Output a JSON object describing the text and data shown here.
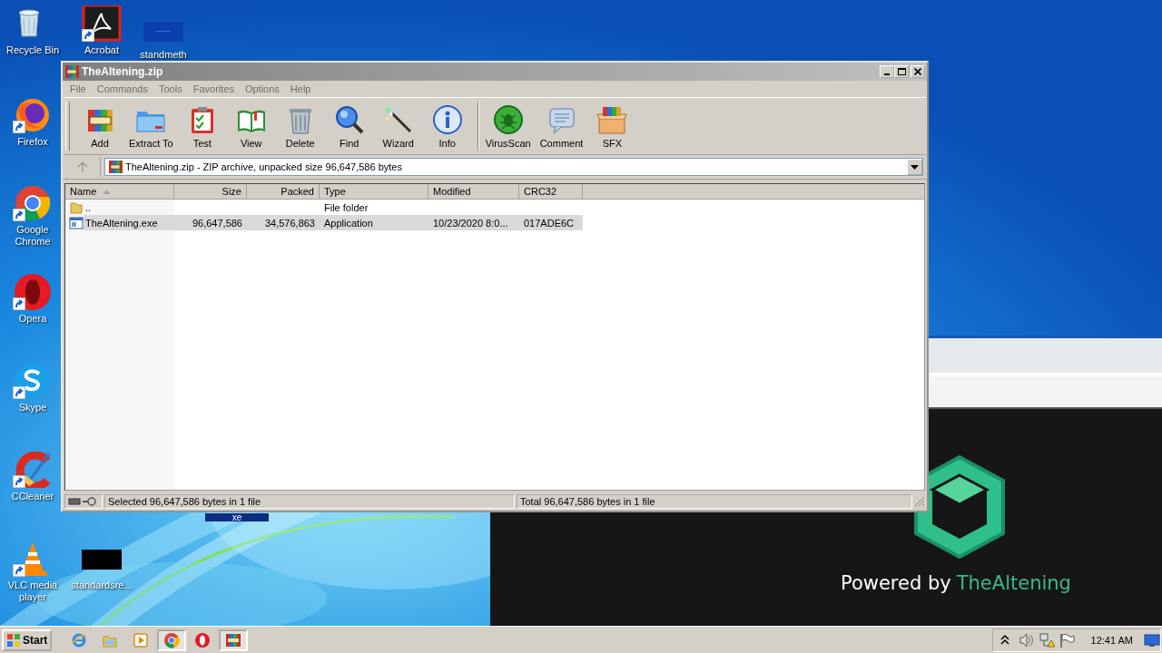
{
  "desktop": {
    "icons": [
      {
        "kind": "recycle",
        "label": "Recycle Bin",
        "shortcut": false
      },
      {
        "kind": "acrobat",
        "label": "Acrobat",
        "shortcut": true
      },
      {
        "kind": "thumb-blue",
        "label": "standmeth",
        "shortcut": false
      },
      {
        "kind": "firefox",
        "label": "Firefox",
        "shortcut": true
      },
      {
        "kind": "chrome",
        "label": "Google Chrome",
        "shortcut": true
      },
      {
        "kind": "opera",
        "label": "Opera",
        "shortcut": true
      },
      {
        "kind": "skype",
        "label": "Skype",
        "shortcut": true
      },
      {
        "kind": "ccleaner",
        "label": "CCleaner",
        "shortcut": true
      },
      {
        "kind": "vlc",
        "label": "VLC media player",
        "shortcut": true
      },
      {
        "kind": "thumb-black",
        "label": "standardsre...",
        "shortcut": false
      }
    ],
    "selected_label": "xe"
  },
  "background_page": {
    "powered_by": "Powered by",
    "brand": "TheAltening"
  },
  "window": {
    "title": "TheAltening.zip",
    "active": false,
    "menu": [
      "File",
      "Commands",
      "Tools",
      "Favorites",
      "Options",
      "Help"
    ],
    "toolbar": [
      {
        "kind": "add",
        "label": "Add"
      },
      {
        "kind": "extract",
        "label": "Extract To"
      },
      {
        "kind": "test",
        "label": "Test"
      },
      {
        "kind": "view",
        "label": "View"
      },
      {
        "kind": "delete",
        "label": "Delete"
      },
      {
        "kind": "find",
        "label": "Find"
      },
      {
        "kind": "wizard",
        "label": "Wizard"
      },
      {
        "kind": "info",
        "label": "Info"
      },
      {
        "kind": "separator"
      },
      {
        "kind": "virusscan",
        "label": "VirusScan"
      },
      {
        "kind": "comment",
        "label": "Comment"
      },
      {
        "kind": "sfx",
        "label": "SFX"
      }
    ],
    "address": "TheAltening.zip - ZIP archive, unpacked size 96,647,586 bytes",
    "table": {
      "columns": [
        {
          "label": "Name",
          "sorted": true
        },
        {
          "label": "Size",
          "sorted": false
        },
        {
          "label": "Packed",
          "sorted": false
        },
        {
          "label": "Type",
          "sorted": false
        },
        {
          "label": "Modified",
          "sorted": false
        },
        {
          "label": "CRC32",
          "sorted": false
        }
      ],
      "rows": [
        {
          "kind": "folder",
          "selected": false,
          "cells": [
            "..",
            "",
            "",
            "File folder",
            "",
            ""
          ]
        },
        {
          "kind": "exe",
          "selected": true,
          "cells": [
            "TheAltening.exe",
            "96,647,586",
            "34,576,863",
            "Application",
            "10/23/2020 8:0...",
            "017ADE6C"
          ]
        }
      ]
    },
    "status_bar": {
      "left": "Selected 96,647,586 bytes in 1 file",
      "right": "Total 96,647,586 bytes in 1 file"
    }
  },
  "taskbar": {
    "start": "Start",
    "apps": [
      {
        "kind": "ie",
        "active": false
      },
      {
        "kind": "explorer",
        "active": false
      },
      {
        "kind": "media",
        "active": false
      },
      {
        "kind": "chrome",
        "active": true
      },
      {
        "kind": "opera",
        "active": false
      },
      {
        "kind": "winrar",
        "active": true
      }
    ],
    "tray": [
      {
        "kind": "chevron"
      },
      {
        "kind": "speaker"
      },
      {
        "kind": "network"
      },
      {
        "kind": "flag"
      }
    ],
    "clock": "12:41 AM"
  }
}
